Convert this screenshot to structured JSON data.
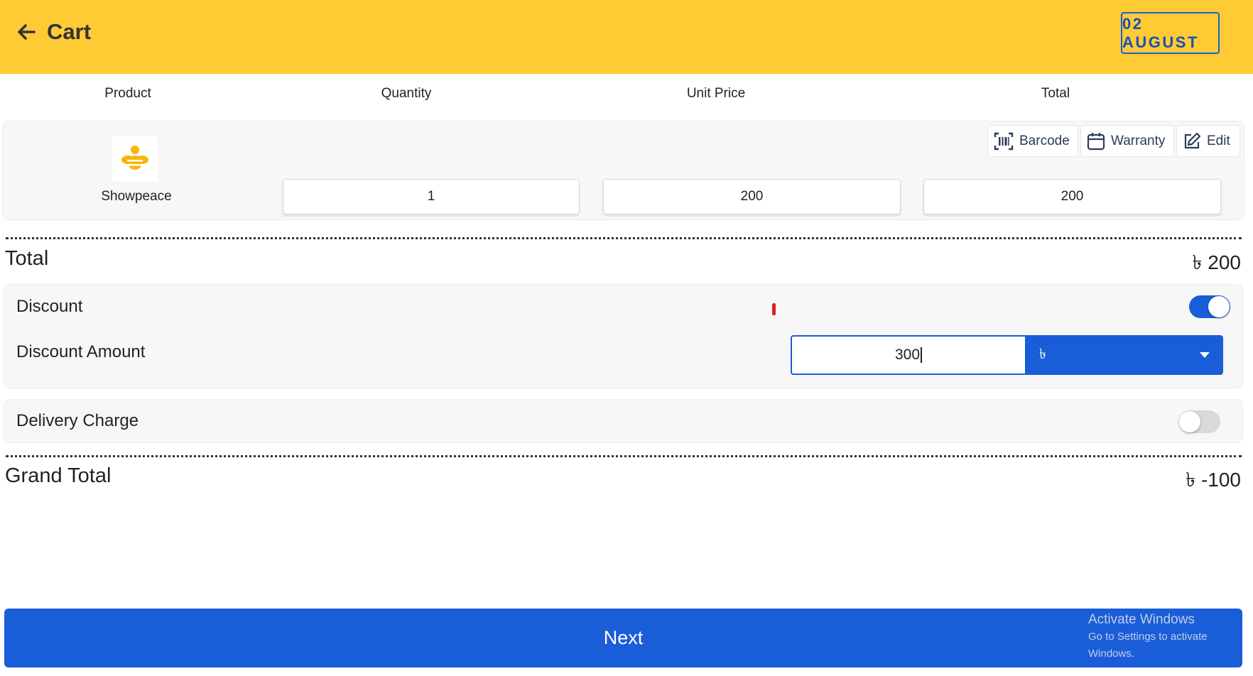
{
  "header": {
    "title": "Cart",
    "date_label": "02 AUGUST",
    "background_color": "#fecb35",
    "back_icon": "arrow-left-icon"
  },
  "columns": {
    "product": "Product",
    "quantity": "Quantity",
    "unit_price": "Unit Price",
    "total": "Total"
  },
  "item": {
    "name": "Showpeace",
    "thumbnail_icon": "bee-logo-icon",
    "quantity": "1",
    "unit_price": "200",
    "total": "200",
    "actions": {
      "barcode": "Barcode",
      "warranty": "Warranty",
      "edit": "Edit"
    }
  },
  "summary": {
    "total_label": "Total",
    "total_value": "৳ 200",
    "discount_label": "Discount",
    "discount_enabled": true,
    "discount_amount_label": "Discount Amount",
    "discount_amount_value": "300",
    "discount_currency": "৳",
    "delivery_label": "Delivery Charge",
    "delivery_enabled": false,
    "grand_total_label": "Grand Total",
    "grand_total_value": "৳ -100"
  },
  "footer": {
    "next_label": "Next"
  },
  "watermark": {
    "line1": "Activate Windows",
    "line2": "Go to Settings to activate Windows."
  },
  "colors": {
    "accent": "#1a5dd8",
    "header": "#fecb35"
  }
}
